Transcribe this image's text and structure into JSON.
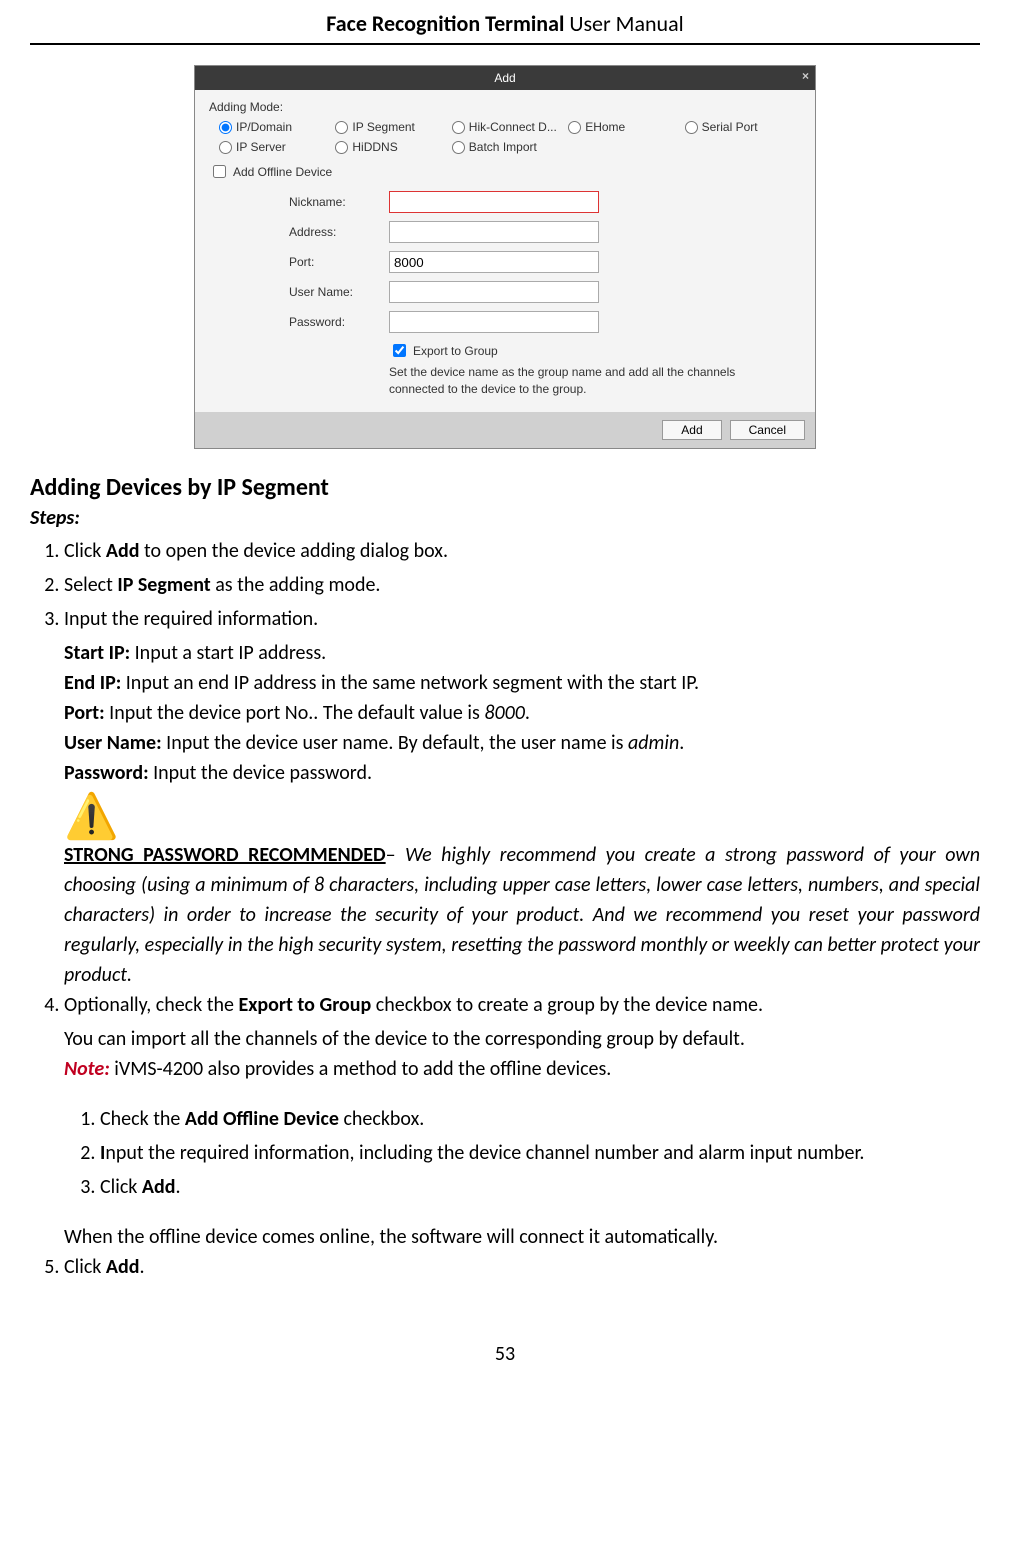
{
  "header": {
    "bold": "Face Recognition Terminal",
    "normal": "  User Manual"
  },
  "dialog": {
    "title": "Add",
    "close": "×",
    "adding_mode_label": "Adding Mode:",
    "radios": {
      "ip_domain": "IP/Domain",
      "ip_segment": "IP Segment",
      "hik_connect": "Hik-Connect D...",
      "ehome": "EHome",
      "serial_port": "Serial Port",
      "ip_server": "IP Server",
      "hiddns": "HiDDNS",
      "batch_import": "Batch Import"
    },
    "add_offline": "Add Offline Device",
    "fields": {
      "nickname": "Nickname:",
      "address": "Address:",
      "port": "Port:",
      "port_value": "8000",
      "username": "User Name:",
      "password": "Password:"
    },
    "export_label": "Export to Group",
    "export_note": "Set the device name as the group name and add all the channels connected to the device to the group.",
    "btn_add": "Add",
    "btn_cancel": "Cancel"
  },
  "section_title": "Adding Devices by IP Segment",
  "steps_label": "Steps:",
  "body": {
    "s1_a": "Click ",
    "s1_b": "Add",
    "s1_c": " to open the device adding dialog box.",
    "s2_a": "Select ",
    "s2_b": "IP Segment",
    "s2_c": " as the adding mode.",
    "s3": "Input the required information.",
    "startip_b": "Start IP:",
    "startip_t": " Input a start IP address.",
    "endip_b": "End IP:",
    "endip_t": " Input an end IP address in the same network segment with the start IP.",
    "port_b": "Port:",
    "port_t1": " Input the device port No.. The default value is ",
    "port_i": "8000",
    "port_t2": ".",
    "user_b": "User Name:",
    "user_t1": " Input the device user name. By default, the user name is ",
    "user_i": "admin",
    "user_t2": ".",
    "pass_b": "Password:",
    "pass_t": " Input the device password.",
    "warn_title": "STRONG PASSWORD RECOMMENDED",
    "warn_dash": "– ",
    "warn_body": "We highly recommend you create a strong password of your own choosing (using a minimum of 8 characters, including upper case letters, lower case letters, numbers, and special characters) in order to increase the security of your product. And we recommend you reset your password regularly, especially in the high security system, resetting the password monthly or weekly can better protect your product.",
    "s4_a": "Optionally, check the ",
    "s4_b": "Export to Group",
    "s4_c": " checkbox to create a group by the device name.",
    "s4_line2": "You can import all the channels of the device to the corresponding group by default.",
    "note_label": "Note:",
    "note_text": " iVMS-4200 also provides a method to add the offline devices.",
    "sub1_a": "Check the ",
    "sub1_b": "Add Offline Device",
    "sub1_c": " checkbox.",
    "sub2_a": "I",
    "sub2_b": "nput the required information, including the device channel number and alarm input number.",
    "sub3_a": "Click ",
    "sub3_b": "Add",
    "sub3_c": ".",
    "s4_after": "When the offline device comes online, the software will connect it automatically.",
    "s5_a": "Click ",
    "s5_b": "Add",
    "s5_c": "."
  },
  "page_number": "53"
}
